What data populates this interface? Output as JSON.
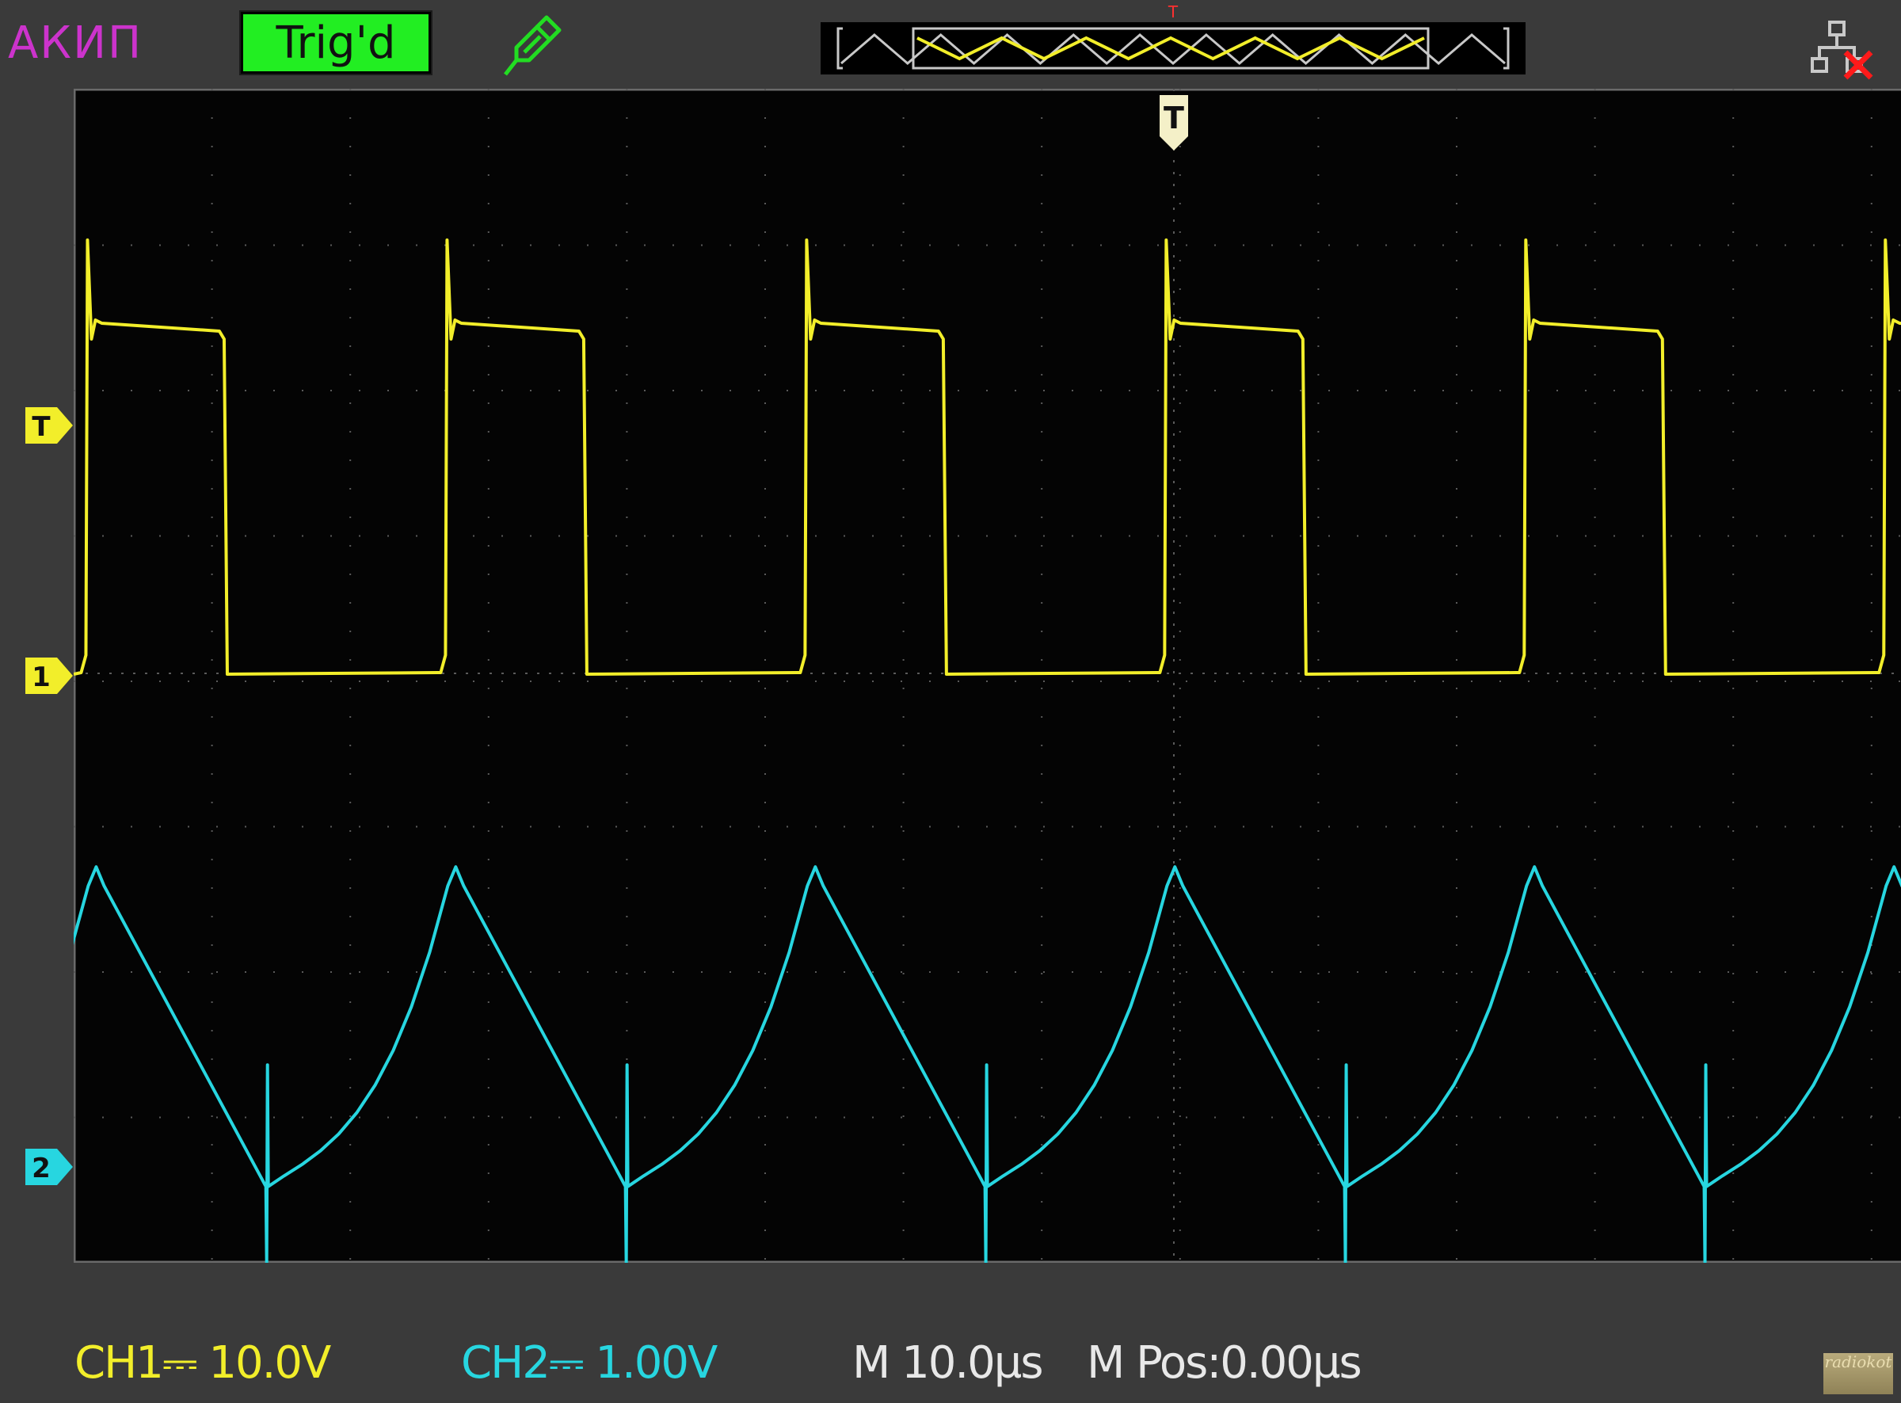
{
  "header": {
    "brand": "АКИП",
    "trigger_status": "Trig'd",
    "trigger_position_mark": "T"
  },
  "markers": {
    "trigger_level": "T",
    "ch1": "1",
    "ch2": "2",
    "trigger_point": "T"
  },
  "status": {
    "ch1": "CH1⎓ 10.0V",
    "ch2": "CH2⎓ 1.00V",
    "timebase": "M 10.0µs",
    "mpos": "M Pos:0.00µs"
  },
  "logo": "radiokot",
  "colors": {
    "brand": "#cc33cc",
    "trig_bg": "#22ee22",
    "ch1": "#f2ee2a",
    "ch2": "#27d6e0",
    "probe_icon": "#22dd22",
    "grid": "#5a5a5a",
    "timebase_text": "#e8e8e8"
  },
  "icons": {
    "probe": "probe-icon",
    "network": "network-disconnected-icon"
  },
  "chart_data": {
    "type": "line",
    "grid": {
      "divisions_x": 14,
      "divisions_y": 8
    },
    "series": [
      {
        "name": "CH1",
        "period_div": 2.6,
        "first_rise_div": 0.1,
        "high_div": 2.8,
        "spike_div": 3.55,
        "low_div": 0.0,
        "duty": 0.38,
        "baseline_y_div": 4.0
      },
      {
        "name": "CH2",
        "period_div": 2.6,
        "first_peak_div": 0.22,
        "peak_div": 1.2,
        "trough_div": -1.15,
        "spike_to_div": -1.75,
        "baseline_y_div": 7.1
      }
    ]
  }
}
